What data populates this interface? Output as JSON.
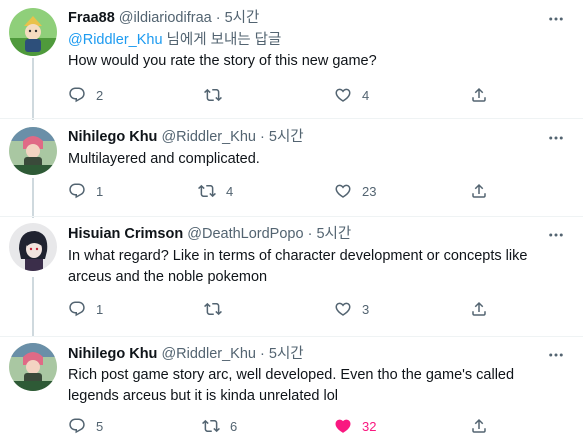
{
  "tweets": [
    {
      "name": "Fraa88",
      "handle": "@ildiariodifraa",
      "dot": "·",
      "time": "5시간",
      "reply_to_handle": "@Riddler_Khu",
      "reply_to_suffix": " 님에게 보내는 답글",
      "text": "How would you rate the story of this new game?",
      "replies": "2",
      "retweets": "",
      "likes": "4"
    },
    {
      "name": "Nihilego Khu",
      "handle": "@Riddler_Khu",
      "dot": "·",
      "time": "5시간",
      "text": "Multilayered and complicated.",
      "replies": "1",
      "retweets": "4",
      "likes": "23"
    },
    {
      "name": "Hisuian Crimson",
      "handle": "@DeathLordPopo",
      "dot": "·",
      "time": "5시간",
      "text": "In what regard? Like in terms of character development or concepts like arceus and the noble pokemon",
      "replies": "1",
      "retweets": "",
      "likes": "3"
    },
    {
      "name": "Nihilego Khu",
      "handle": "@Riddler_Khu",
      "dot": "·",
      "time": "5시간",
      "text": "Rich post game story arc, well developed. Even tho the game's called legends arceus but it is kinda unrelated lol",
      "replies": "5",
      "retweets": "6",
      "likes": "32",
      "liked": true
    }
  ],
  "colors": {
    "text": "#0f1419",
    "secondary": "#536471",
    "link": "#1d9bf0",
    "like_active": "#f91880",
    "divider": "#eff3f4",
    "thread_line": "#cfd9de"
  },
  "icons": [
    "reply-icon",
    "retweet-icon",
    "like-icon",
    "share-icon",
    "more-icon"
  ]
}
